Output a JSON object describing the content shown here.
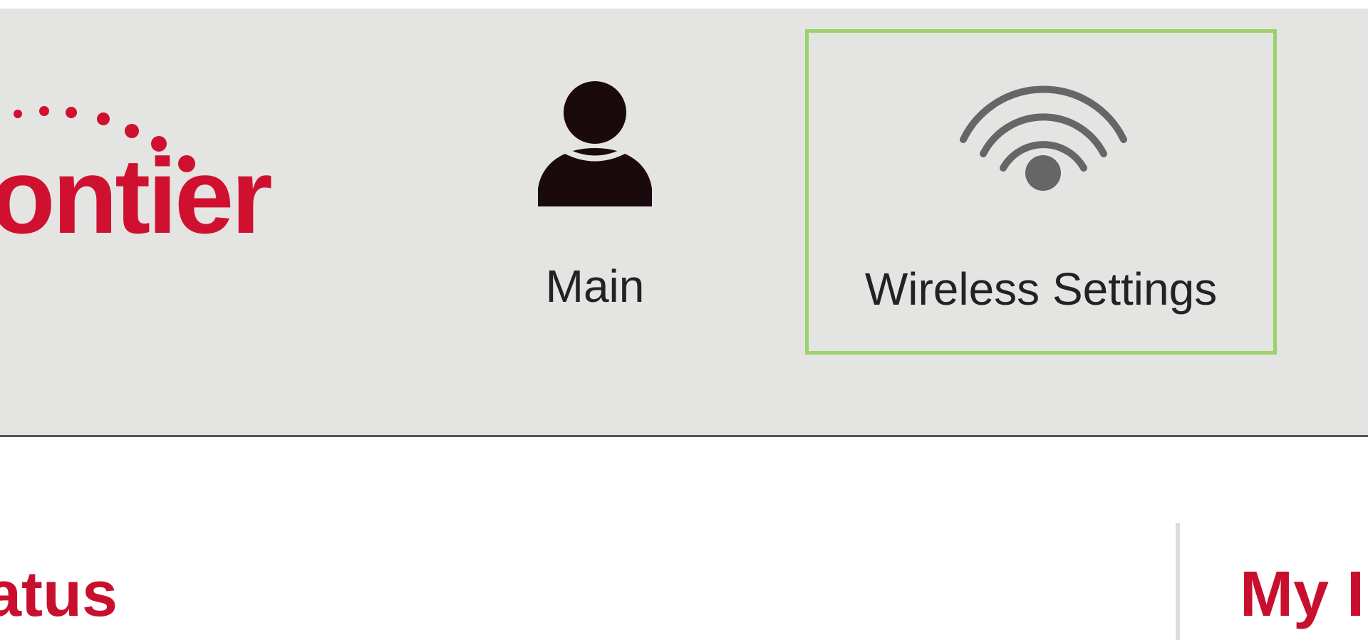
{
  "brand": {
    "logo_text": "ontier",
    "logo_color": "#d0102f"
  },
  "nav": {
    "items": [
      {
        "label": "Main",
        "icon": "user-icon",
        "selected": false
      },
      {
        "label": "Wireless Settings",
        "icon": "wifi-icon",
        "selected": true
      }
    ],
    "selected_border_color": "#9bd26a"
  },
  "sections": {
    "status_heading": "atus",
    "network_heading": "My I",
    "heading_color": "#c8102e"
  }
}
